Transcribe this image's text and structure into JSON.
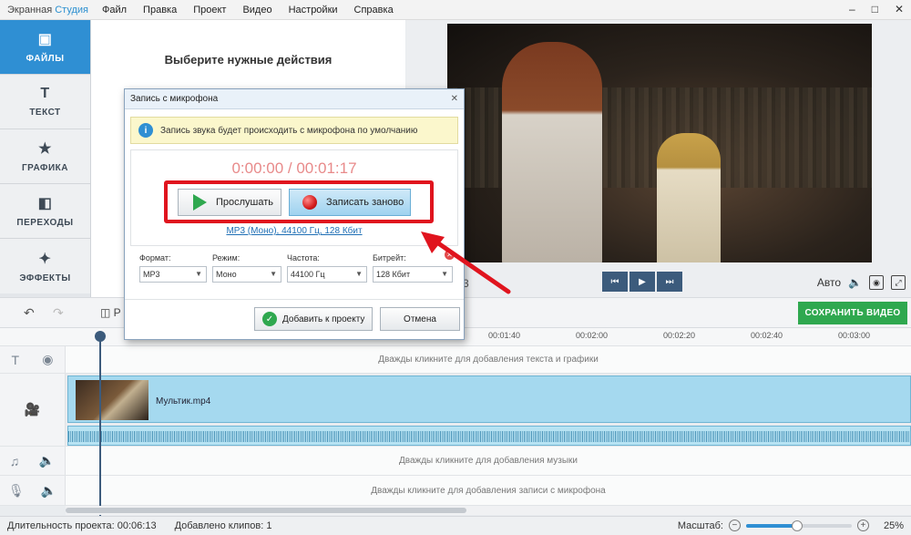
{
  "app": {
    "title_plain": "Экранная ",
    "title_accent": "Студия"
  },
  "menu": [
    "Файл",
    "Правка",
    "Проект",
    "Видео",
    "Настройки",
    "Справка"
  ],
  "window_controls": {
    "min": "–",
    "max": "□",
    "close": "✕"
  },
  "nav": [
    {
      "label": "ФАЙЛЫ",
      "icon": "image-icon",
      "glyph": "▣"
    },
    {
      "label": "ТЕКСТ",
      "icon": "text-icon",
      "glyph": "T"
    },
    {
      "label": "ГРАФИКА",
      "icon": "star-icon",
      "glyph": "★"
    },
    {
      "label": "ПЕРЕХОДЫ",
      "icon": "transitions-icon",
      "glyph": "◧"
    },
    {
      "label": "ЭФФЕКТЫ",
      "icon": "magic-wand-icon",
      "glyph": "✦"
    }
  ],
  "actions_panel": {
    "title": "Выберите нужные действия"
  },
  "preview": {
    "time_tail": "3",
    "auto_label": "Авто",
    "controls": {
      "prev": "⏮",
      "play": "▶",
      "next": "⏭"
    }
  },
  "toolbar": {
    "split_label": "Р",
    "save_label": "СОХРАНИТЬ ВИДЕО"
  },
  "ruler_ticks": [
    "00:01:40",
    "00:02:00",
    "00:02:20",
    "00:02:40",
    "00:03:00"
  ],
  "tracks": {
    "text_hint": "Дважды кликните для добавления текста и графики",
    "music_hint": "Дважды кликните для добавления музыки",
    "mic_hint": "Дважды кликните для добавления записи с микрофона"
  },
  "clip": {
    "name": "Мультик.mp4"
  },
  "status": {
    "duration_label": "Длительность проекта: 00:06:13",
    "clips_label": "Добавлено клипов: 1",
    "zoom_label": "Масштаб:",
    "zoom_value": "25%",
    "zoom_fraction": 0.48
  },
  "dialog": {
    "title": "Запись с микрофона",
    "info_text": "Запись звука будет происходить с микрофона по умолчанию",
    "timer": "0:00:00 / 00:01:17",
    "listen_label": "Прослушать",
    "rerecord_label": "Записать заново",
    "format_link": "MP3 (Моно), 44100 Гц, 128 Кбит",
    "params": [
      {
        "label": "Формат:",
        "value": "MP3"
      },
      {
        "label": "Режим:",
        "value": "Моно"
      },
      {
        "label": "Частота:",
        "value": "44100 Гц"
      },
      {
        "label": "Битрейт:",
        "value": "128 Кбит"
      }
    ],
    "add_label": "Добавить к проекту",
    "cancel_label": "Отмена"
  },
  "colors": {
    "accent": "#2f8fd3",
    "save": "#2fa84f",
    "highlight": "#e0141e"
  }
}
